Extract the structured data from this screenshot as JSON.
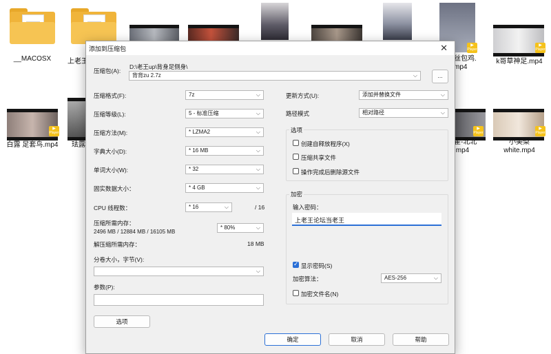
{
  "desktop": {
    "files": [
      {
        "label": "__MACOSX"
      },
      {
        "label": "上老王"
      },
      {
        "label": "丝包鸡.\nmp4"
      },
      {
        "label": "k哥草神足.mp4"
      },
      {
        "label": "白露 足套鸟.mp4"
      },
      {
        "label": "珐露"
      },
      {
        "label": "霍-北北\n.mp4"
      },
      {
        "label": "小美梨\nwhite.mp4"
      }
    ],
    "badge_text": "Player"
  },
  "dialog": {
    "title": "添加到压缩包",
    "archive_label": "压缩包(A):",
    "archive_path": "D:\\老王up\\背身足侧身\\",
    "archive_name": "背背zu 2.7z",
    "browse_label": "...",
    "left": {
      "format": {
        "label": "压缩格式(F):",
        "value": "7z"
      },
      "level": {
        "label": "压缩等级(L):",
        "value": "5 - 标准压缩"
      },
      "method": {
        "label": "压缩方法(M):",
        "value": "* LZMA2"
      },
      "dict": {
        "label": "字典大小(D):",
        "value": "* 16 MB"
      },
      "word": {
        "label": "单词大小(W):",
        "value": "* 32"
      },
      "solid": {
        "label": "固实数据大小：",
        "value": "* 4 GB"
      },
      "cpu": {
        "label": "CPU 线程数：",
        "value": "* 16",
        "max": "/ 16"
      },
      "mem": {
        "label": "压缩所需内存：",
        "detail": "2496 MB / 12884 MB / 16105 MB",
        "value": "* 80%"
      },
      "decomp": {
        "label": "解压缩所需内存：",
        "value": "18 MB"
      },
      "split": {
        "label": "分卷大小，字节(V):",
        "value": ""
      },
      "params": {
        "label": "参数(P):",
        "value": ""
      },
      "options_button": "选项"
    },
    "right": {
      "update": {
        "label": "更新方式(U):",
        "value": "添加并替换文件"
      },
      "pathmode": {
        "label": "路径模式",
        "value": "相对路径"
      },
      "options_title": "选项",
      "opt_sfx": "创建自释放程序(X)",
      "opt_shared": "压缩共享文件",
      "opt_delete": "操作完成后删除源文件",
      "enc_title": "加密",
      "pw_label": "输入密码：",
      "pw_value": "上老王论坛当老王",
      "show_pw": "显示密码(S)",
      "enc_method_label": "加密算法：",
      "enc_method_value": "AES-256",
      "enc_names": "加密文件名(N)"
    },
    "buttons": {
      "ok": "确定",
      "cancel": "取消",
      "help": "帮助"
    }
  }
}
